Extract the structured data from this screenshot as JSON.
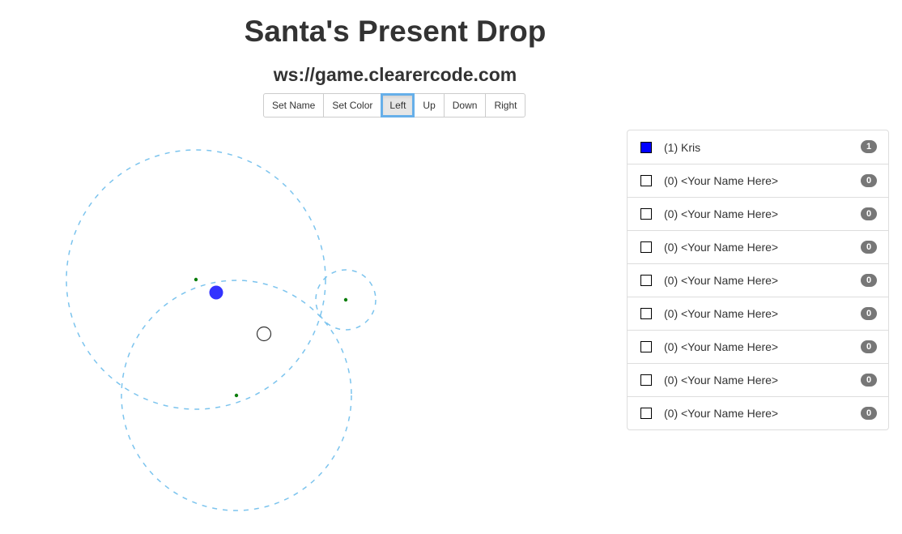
{
  "header": {
    "title": "Santa's Present Drop",
    "server_url": "ws://game.clearercode.com"
  },
  "toolbar": {
    "buttons": [
      {
        "label": "Set Name",
        "active": false
      },
      {
        "label": "Set Color",
        "active": false
      },
      {
        "label": "Left",
        "active": true
      },
      {
        "label": "Up",
        "active": false
      },
      {
        "label": "Down",
        "active": false
      },
      {
        "label": "Right",
        "active": false
      }
    ]
  },
  "game": {
    "colors": {
      "zone_ring": "#7cc4ee",
      "target": "#0a7d0a",
      "player": "#3333ff",
      "cursor_ring": "#333333"
    },
    "entities": [
      {
        "type": "drop-zone",
        "center_marker": true
      },
      {
        "type": "drop-zone",
        "center_marker": true
      },
      {
        "type": "drop-zone",
        "center_marker": true
      },
      {
        "type": "player",
        "name": "Kris"
      },
      {
        "type": "present"
      }
    ]
  },
  "players": [
    {
      "label": "(1) Kris",
      "score": "1",
      "color": "#0000ff"
    },
    {
      "label": "(0) <Your Name Here>",
      "score": "0",
      "color": "#ffffff"
    },
    {
      "label": "(0) <Your Name Here>",
      "score": "0",
      "color": "#ffffff"
    },
    {
      "label": "(0) <Your Name Here>",
      "score": "0",
      "color": "#ffffff"
    },
    {
      "label": "(0) <Your Name Here>",
      "score": "0",
      "color": "#ffffff"
    },
    {
      "label": "(0) <Your Name Here>",
      "score": "0",
      "color": "#ffffff"
    },
    {
      "label": "(0) <Your Name Here>",
      "score": "0",
      "color": "#ffffff"
    },
    {
      "label": "(0) <Your Name Here>",
      "score": "0",
      "color": "#ffffff"
    },
    {
      "label": "(0) <Your Name Here>",
      "score": "0",
      "color": "#ffffff"
    }
  ]
}
